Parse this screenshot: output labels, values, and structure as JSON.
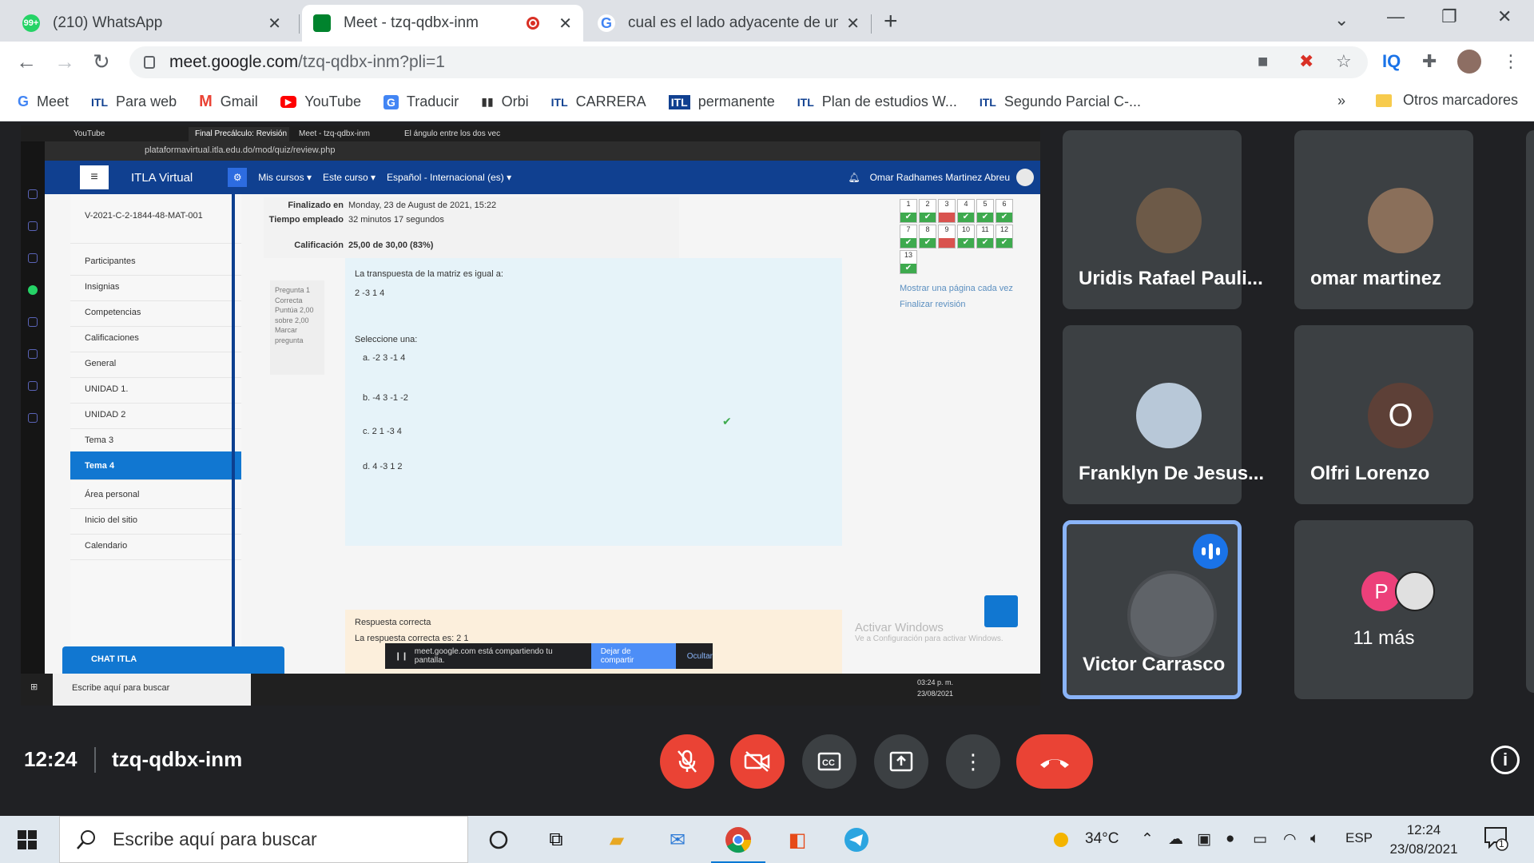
{
  "browser": {
    "tabs": [
      {
        "title": "(210) WhatsApp",
        "badge": "99+"
      },
      {
        "title": "Meet - tzq-qdbx-inm"
      },
      {
        "title": "cual es el lado adyacente de un t"
      }
    ],
    "url_host": "meet.google.com",
    "url_path": "/tzq-qdbx-inm?pli=1",
    "bookmarks": [
      "Meet",
      "Para web",
      "Gmail",
      "YouTube",
      "Traducir",
      "Orbi",
      "CARRERA",
      "permanente",
      "Plan de estudios W...",
      "Segundo Parcial C-..."
    ],
    "bookmarks_more": "»",
    "other_bookmarks": "Otros marcadores"
  },
  "shared_screen": {
    "inner_tabs": [
      "YouTube",
      "Final Precálculo: Revisión d",
      "Meet - tzq-qdbx-inm",
      "El ángulo entre los dos vec"
    ],
    "inner_url": "plataformavirtual.itla.edu.do/mod/quiz/review.php",
    "site_name": "ITLA Virtual",
    "nav_links": [
      "Mis cursos ▾",
      "Este curso ▾",
      "Español - Internacional (es) ▾"
    ],
    "user_name": "Omar Radhames Martinez Abreu",
    "course_code": "V-2021-C-2-1844-48-MAT-001",
    "left_nav": [
      "Participantes",
      "Insignias",
      "Competencias",
      "Calificaciones",
      "General",
      "UNIDAD 1.",
      "UNIDAD 2",
      "Tema 3",
      "Tema 4",
      "Área personal",
      "Inicio del sitio",
      "Calendario"
    ],
    "chat_label": "CHAT ITLA",
    "summary": [
      {
        "k": "Finalizado en",
        "v": "Monday, 23 de August de 2021, 15:22"
      },
      {
        "k": "Tiempo empleado",
        "v": "32 minutos 17 segundos"
      },
      {
        "k": "Calificación",
        "v": "25,00 de 30,00 (83%)"
      }
    ],
    "question_info": "Pregunta 1 Correcta Puntúa 2,00 sobre 2,00 Marcar pregunta",
    "question_text": "La transpuesta de la matriz es igual a:",
    "matrix": "2   -3   1   4",
    "select_one": "Seleccione una:",
    "options": [
      "a.  -2   3   -1   4",
      "b.  -4   3   -1   -2",
      "c.  2   1   -3   4",
      "d.  4   -3   1   2"
    ],
    "correct_label": "Respuesta correcta",
    "correct_answer": "La respuesta correcta es: 2   1",
    "question_numbers": [
      "1",
      "2",
      "3",
      "4",
      "5",
      "6",
      "7",
      "8",
      "9",
      "10",
      "11",
      "12",
      "13"
    ],
    "show_one_page": "Mostrar una página cada vez",
    "finish_review": "Finalizar revisión",
    "activate_title": "Activar Windows",
    "activate_sub": "Ve a Configuración para activar Windows.",
    "share_msg": "meet.google.com está compartiendo tu pantalla.",
    "stop_sharing": "Dejar de compartir",
    "hide": "Ocultar",
    "inner_search": "Escribe aquí para buscar",
    "inner_time": "03:24 p. m.",
    "inner_date": "23/08/2021"
  },
  "participants": [
    {
      "name": "Uridis Rafael Pauli..."
    },
    {
      "name": "omar martinez"
    },
    {
      "name": "Franklyn De Jesus..."
    },
    {
      "name": "Olfri Lorenzo",
      "initial": "O"
    },
    {
      "name": "Victor Carrasco"
    }
  ],
  "more": {
    "initial": "P",
    "label": "11 más"
  },
  "meeting": {
    "time": "12:24",
    "code": "tzq-qdbx-inm"
  },
  "taskbar": {
    "search_placeholder": "Escribe aquí para buscar",
    "temperature": "34°C",
    "language": "ESP",
    "time": "12:24",
    "date": "23/08/2021",
    "notifications": "1"
  },
  "colors": {
    "meet_bg": "#202124",
    "tile_bg": "#3c4043",
    "danger": "#ea4335",
    "accent": "#1a73e8",
    "moodle_nav": "#104090"
  }
}
